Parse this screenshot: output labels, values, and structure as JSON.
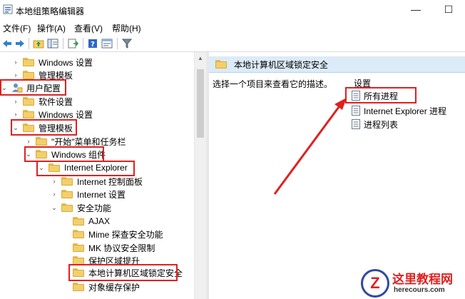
{
  "window": {
    "title": "本地组策略编辑器",
    "minimize_glyph": "—",
    "maximize_glyph": "☐"
  },
  "menu": [
    "文件(F)",
    "操作(A)",
    "查看(V)",
    "帮助(H)"
  ],
  "toolbar": {
    "icons": [
      "back-arrow-icon",
      "forward-arrow-icon",
      "up-folder-icon",
      "show-hide-tree-icon",
      "export-list-icon",
      "help-icon",
      "properties-icon",
      "filter-icon"
    ]
  },
  "tree": [
    {
      "label": "Windows 设置",
      "toggle": "›",
      "icon": "folder"
    },
    {
      "label": "管理模板",
      "toggle": "›",
      "icon": "folder"
    },
    {
      "label": "用户配置",
      "toggle": "⌄",
      "icon": "user"
    },
    {
      "label": "软件设置",
      "toggle": "›",
      "icon": "folder"
    },
    {
      "label": "Windows 设置",
      "toggle": "›",
      "icon": "folder"
    },
    {
      "label": "管理模板",
      "toggle": "⌄",
      "icon": "folder"
    },
    {
      "label": "\"开始\"菜单和任务栏",
      "toggle": "›",
      "icon": "folder"
    },
    {
      "label": "Windows 组件",
      "toggle": "⌄",
      "icon": "folder"
    },
    {
      "label": "Internet Explorer",
      "toggle": "⌄",
      "icon": "folder"
    },
    {
      "label": "Internet 控制面板",
      "toggle": "›",
      "icon": "folder"
    },
    {
      "label": "Internet 设置",
      "toggle": "›",
      "icon": "folder"
    },
    {
      "label": "安全功能",
      "toggle": "⌄",
      "icon": "folder"
    },
    {
      "label": "AJAX",
      "toggle": "",
      "icon": "folder"
    },
    {
      "label": "Mime 探查安全功能",
      "toggle": "",
      "icon": "folder"
    },
    {
      "label": "MK 协议安全限制",
      "toggle": "",
      "icon": "folder"
    },
    {
      "label": "保护区域提升",
      "toggle": "",
      "icon": "folder"
    },
    {
      "label": "本地计算机区域锁定安全",
      "toggle": "",
      "icon": "folder"
    },
    {
      "label": "对象缓存保护",
      "toggle": "",
      "icon": "folder"
    }
  ],
  "detail": {
    "header": "本地计算机区域锁定安全",
    "description": "选择一个项目来查看它的描述。",
    "column_label": "设置",
    "settings": [
      "所有进程",
      "Internet Explorer 进程",
      "进程列表"
    ]
  },
  "watermark": {
    "title": "这里教程网",
    "subtitle": "herecours.com",
    "logo_letter": "Z"
  },
  "colors": {
    "highlight_red": "#e02020",
    "header_blue": "#dcebf8",
    "folder_yellow": "#f3cf6c"
  }
}
